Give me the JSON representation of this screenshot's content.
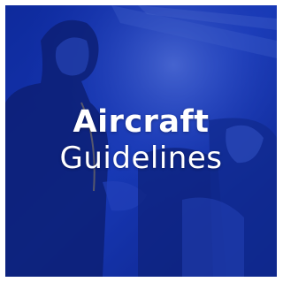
{
  "tile": {
    "title_line1": "Aircraft",
    "title_line2": "Guidelines"
  },
  "colors": {
    "overlay": "#1a3ab4",
    "text": "#ffffff"
  }
}
